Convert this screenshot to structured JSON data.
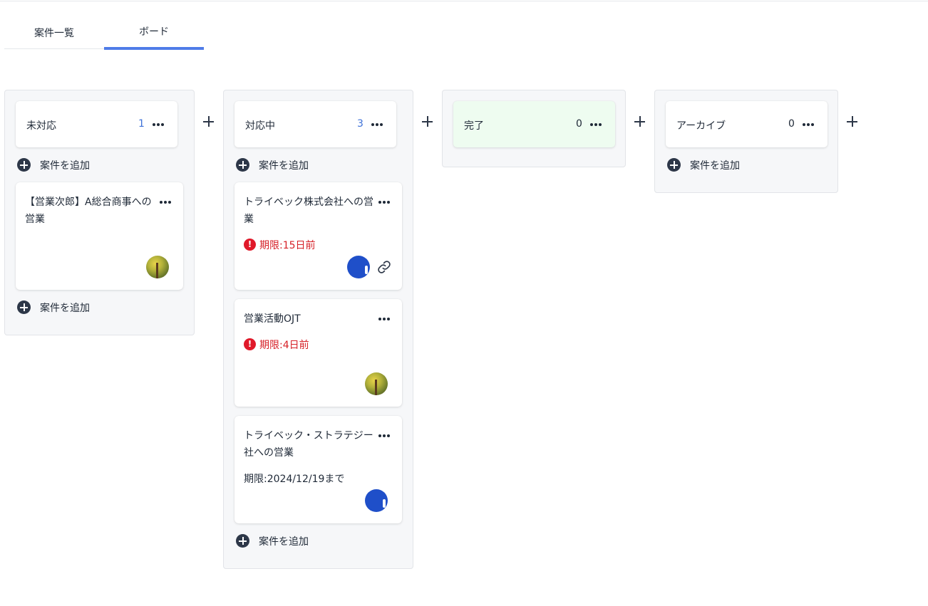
{
  "tabs": [
    {
      "label": "案件一覧"
    },
    {
      "label": "ボード"
    }
  ],
  "add_card_label": "案件を追加",
  "columns": [
    {
      "title": "未対応",
      "count": "1",
      "cards": [
        {
          "title": "【営業次郎】A総合商事への営業",
          "avatar": "tree"
        }
      ]
    },
    {
      "title": "対応中",
      "count": "3",
      "cards": [
        {
          "title": "トライベック株式会社への営業",
          "deadline": "期限:15日前",
          "overdue": true,
          "avatar": "blue",
          "has_link": true
        },
        {
          "title": "営業活動OJT",
          "deadline": "期限:4日前",
          "overdue": true,
          "avatar": "tree"
        },
        {
          "title": "トライベック・ストラテジー社への営業",
          "deadline": "期限:2024/12/19まで",
          "overdue": false,
          "avatar": "blue"
        }
      ]
    },
    {
      "title": "完了",
      "count": "0",
      "cards": []
    },
    {
      "title": "アーカイブ",
      "count": "0",
      "cards": []
    }
  ],
  "warning_glyph": "!",
  "colors": {
    "accent": "#4f7ce8",
    "count_blue": "#3f72d8",
    "overdue_red": "#d62027",
    "done_header_bg": "#eefcf0",
    "column_bg": "#f6f7f9"
  }
}
